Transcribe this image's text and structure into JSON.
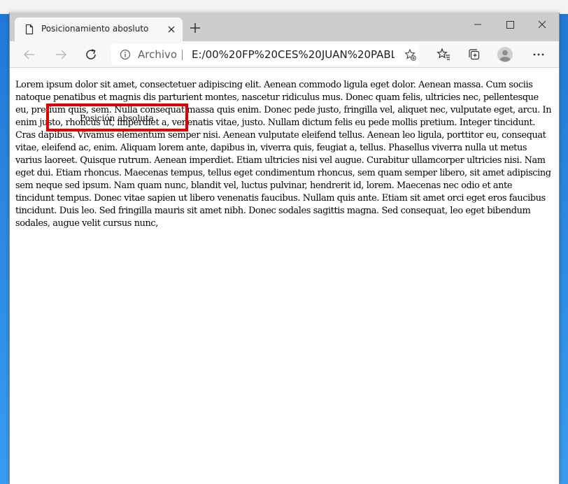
{
  "browser": {
    "tab": {
      "title": "Posicionamiento abosluto",
      "page_icon": "page-icon",
      "close_icon": "close-icon"
    },
    "new_tab_icon": "plus-icon",
    "window_controls": [
      "minimize-icon",
      "maximize-icon",
      "close-icon"
    ],
    "toolbar": {
      "back_icon": "arrow-left-icon",
      "forward_icon": "arrow-right-icon",
      "refresh_icon": "refresh-icon",
      "address": {
        "info_icon": "info-icon",
        "scheme_label": "Archivo",
        "url": "E:/00%20FP%20CES%20JUAN%20PABL...",
        "add_favorite_icon": "star-add-icon"
      },
      "favorites_icon": "favorites-icon",
      "collections_icon": "collections-icon",
      "profile_icon": "avatar",
      "more_icon": "ellipsis-icon"
    }
  },
  "page": {
    "paragraph": "Lorem ipsum dolor sit amet, consectetuer adipiscing elit. Aenean commodo ligula eget dolor. Aenean massa. Cum sociis natoque penatibus et magnis dis parturient montes, nascetur ridiculus mus. Donec quam felis, ultricies nec, pellentesque eu, pretium quis, sem. Nulla consequat massa quis enim. Donec pede justo, fringilla vel, aliquet nec, vulputate eget, arcu. In enim justo, rhoncus ut, imperdiet a, venenatis vitae, justo. Nullam dictum felis eu pede mollis pretium. Integer tincidunt. Cras dapibus. Vivamus elementum semper nisi. Aenean vulputate eleifend tellus. Aenean leo ligula, porttitor eu, consequat vitae, eleifend ac, enim. Aliquam lorem ante, dapibus in, viverra quis, feugiat a, tellus. Phasellus viverra nulla ut metus varius laoreet. Quisque rutrum. Aenean imperdiet. Etiam ultricies nisi vel augue. Curabitur ullamcorper ultricies nisi. Nam eget dui. Etiam rhoncus. Maecenas tempus, tellus eget condimentum rhoncus, sem quam semper libero, sit amet adipiscing sem neque sed ipsum. Nam quam nunc, blandit vel, luctus pulvinar, hendrerit id, lorem. Maecenas nec odio et ante tincidunt tempus. Donec vitae sapien ut libero venenatis faucibus. Nullam quis ante. Etiam sit amet orci eget eros faucibus tincidunt. Duis leo. Sed fringilla mauris sit amet nibh. Donec sodales sagittis magna. Sed consequat, leo eget bibendum sodales, augue velit cursus nunc,",
    "absolute_box": {
      "label": "Posición absoluta",
      "border_color": "#e00000"
    }
  }
}
